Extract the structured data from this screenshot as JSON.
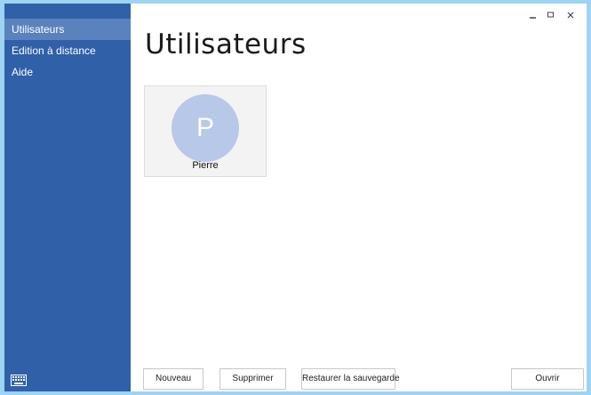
{
  "sidebar": {
    "items": [
      {
        "label": "Utilisateurs",
        "active": true
      },
      {
        "label": "Edition à distance",
        "active": false
      },
      {
        "label": "Aide",
        "active": false
      }
    ],
    "bottom_icon": "keyboard-icon"
  },
  "window_controls": {
    "minimize_icon": "minimize-icon",
    "maximize_icon": "maximize-icon",
    "close_icon": "close-icon"
  },
  "main": {
    "title": "Utilisateurs",
    "users": [
      {
        "initial": "P",
        "name": "Pierre"
      }
    ]
  },
  "buttons": {
    "new_label": "Nouveau",
    "delete_label": "Supprimer",
    "restore_label": "Restaurer la sauvegarde",
    "open_label": "Ouvrir"
  },
  "colors": {
    "sidebar_bg": "#3060a8",
    "sidebar_active": "#5a82bd",
    "window_border": "#9dd3f3",
    "avatar_bg": "#b8c8e8"
  }
}
